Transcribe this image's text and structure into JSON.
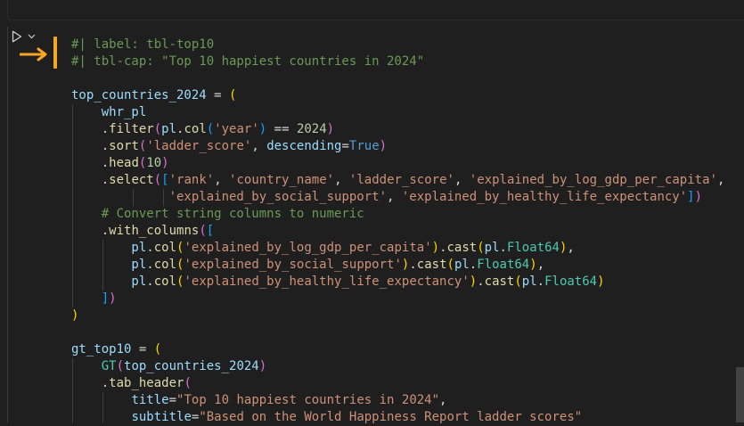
{
  "cell": {
    "run_button": "run-cell",
    "lines": [
      [
        {
          "t": "#| label: tbl-top10",
          "c": "tok-c"
        }
      ],
      [
        {
          "t": "#| tbl-cap: \"Top 10 happiest countries in 2024\"",
          "c": "tok-c"
        }
      ],
      [
        {
          "t": "",
          "c": "tok-op"
        }
      ],
      [
        {
          "t": "top_countries_2024",
          "c": "tok-v"
        },
        {
          "t": " = ",
          "c": "tok-op"
        },
        {
          "t": "(",
          "c": "tok-p1"
        }
      ],
      [
        {
          "t": "    whr_pl",
          "c": "tok-v"
        }
      ],
      [
        {
          "t": "    .",
          "c": "tok-op"
        },
        {
          "t": "filter",
          "c": "tok-f"
        },
        {
          "t": "(",
          "c": "tok-p2"
        },
        {
          "t": "pl",
          "c": "tok-v"
        },
        {
          "t": ".",
          "c": "tok-op"
        },
        {
          "t": "col",
          "c": "tok-f"
        },
        {
          "t": "(",
          "c": "tok-p3"
        },
        {
          "t": "'year'",
          "c": "tok-s"
        },
        {
          "t": ")",
          "c": "tok-p3"
        },
        {
          "t": " == ",
          "c": "tok-op"
        },
        {
          "t": "2024",
          "c": "tok-n"
        },
        {
          "t": ")",
          "c": "tok-p2"
        }
      ],
      [
        {
          "t": "    .",
          "c": "tok-op"
        },
        {
          "t": "sort",
          "c": "tok-f"
        },
        {
          "t": "(",
          "c": "tok-p2"
        },
        {
          "t": "'ladder_score'",
          "c": "tok-s"
        },
        {
          "t": ", ",
          "c": "tok-op"
        },
        {
          "t": "descending",
          "c": "tok-v"
        },
        {
          "t": "=",
          "c": "tok-op"
        },
        {
          "t": "True",
          "c": "tok-k"
        },
        {
          "t": ")",
          "c": "tok-p2"
        }
      ],
      [
        {
          "t": "    .",
          "c": "tok-op"
        },
        {
          "t": "head",
          "c": "tok-f"
        },
        {
          "t": "(",
          "c": "tok-p2"
        },
        {
          "t": "10",
          "c": "tok-n"
        },
        {
          "t": ")",
          "c": "tok-p2"
        }
      ],
      [
        {
          "t": "    .",
          "c": "tok-op"
        },
        {
          "t": "select",
          "c": "tok-f"
        },
        {
          "t": "(",
          "c": "tok-p2"
        },
        {
          "t": "[",
          "c": "tok-p3"
        },
        {
          "t": "'rank'",
          "c": "tok-s"
        },
        {
          "t": ", ",
          "c": "tok-op"
        },
        {
          "t": "'country_name'",
          "c": "tok-s"
        },
        {
          "t": ", ",
          "c": "tok-op"
        },
        {
          "t": "'ladder_score'",
          "c": "tok-s"
        },
        {
          "t": ", ",
          "c": "tok-op"
        },
        {
          "t": "'explained_by_log_gdp_per_capita'",
          "c": "tok-s"
        },
        {
          "t": ",",
          "c": "tok-op"
        }
      ],
      [
        {
          "t": "             ",
          "c": "tok-op"
        },
        {
          "t": "'explained_by_social_support'",
          "c": "tok-s"
        },
        {
          "t": ", ",
          "c": "tok-op"
        },
        {
          "t": "'explained_by_healthy_life_expectancy'",
          "c": "tok-s"
        },
        {
          "t": "]",
          "c": "tok-p3"
        },
        {
          "t": ")",
          "c": "tok-p2"
        }
      ],
      [
        {
          "t": "    # Convert string columns to numeric",
          "c": "tok-c"
        }
      ],
      [
        {
          "t": "    .",
          "c": "tok-op"
        },
        {
          "t": "with_columns",
          "c": "tok-f"
        },
        {
          "t": "(",
          "c": "tok-p2"
        },
        {
          "t": "[",
          "c": "tok-p3"
        }
      ],
      [
        {
          "t": "        pl",
          "c": "tok-v"
        },
        {
          "t": ".",
          "c": "tok-op"
        },
        {
          "t": "col",
          "c": "tok-f"
        },
        {
          "t": "(",
          "c": "tok-p1"
        },
        {
          "t": "'explained_by_log_gdp_per_capita'",
          "c": "tok-s"
        },
        {
          "t": ")",
          "c": "tok-p1"
        },
        {
          "t": ".",
          "c": "tok-op"
        },
        {
          "t": "cast",
          "c": "tok-f"
        },
        {
          "t": "(",
          "c": "tok-p1"
        },
        {
          "t": "pl",
          "c": "tok-v"
        },
        {
          "t": ".",
          "c": "tok-op"
        },
        {
          "t": "Float64",
          "c": "tok-cls"
        },
        {
          "t": ")",
          "c": "tok-p1"
        },
        {
          "t": ",",
          "c": "tok-op"
        }
      ],
      [
        {
          "t": "        pl",
          "c": "tok-v"
        },
        {
          "t": ".",
          "c": "tok-op"
        },
        {
          "t": "col",
          "c": "tok-f"
        },
        {
          "t": "(",
          "c": "tok-p1"
        },
        {
          "t": "'explained_by_social_support'",
          "c": "tok-s"
        },
        {
          "t": ")",
          "c": "tok-p1"
        },
        {
          "t": ".",
          "c": "tok-op"
        },
        {
          "t": "cast",
          "c": "tok-f"
        },
        {
          "t": "(",
          "c": "tok-p1"
        },
        {
          "t": "pl",
          "c": "tok-v"
        },
        {
          "t": ".",
          "c": "tok-op"
        },
        {
          "t": "Float64",
          "c": "tok-cls"
        },
        {
          "t": ")",
          "c": "tok-p1"
        },
        {
          "t": ",",
          "c": "tok-op"
        }
      ],
      [
        {
          "t": "        pl",
          "c": "tok-v"
        },
        {
          "t": ".",
          "c": "tok-op"
        },
        {
          "t": "col",
          "c": "tok-f"
        },
        {
          "t": "(",
          "c": "tok-p1"
        },
        {
          "t": "'explained_by_healthy_life_expectancy'",
          "c": "tok-s"
        },
        {
          "t": ")",
          "c": "tok-p1"
        },
        {
          "t": ".",
          "c": "tok-op"
        },
        {
          "t": "cast",
          "c": "tok-f"
        },
        {
          "t": "(",
          "c": "tok-p1"
        },
        {
          "t": "pl",
          "c": "tok-v"
        },
        {
          "t": ".",
          "c": "tok-op"
        },
        {
          "t": "Float64",
          "c": "tok-cls"
        },
        {
          "t": ")",
          "c": "tok-p1"
        }
      ],
      [
        {
          "t": "    ",
          "c": "tok-op"
        },
        {
          "t": "]",
          "c": "tok-p3"
        },
        {
          "t": ")",
          "c": "tok-p2"
        }
      ],
      [
        {
          "t": ")",
          "c": "tok-p1"
        }
      ],
      [
        {
          "t": "",
          "c": "tok-op"
        }
      ],
      [
        {
          "t": "gt_top10",
          "c": "tok-v"
        },
        {
          "t": " = ",
          "c": "tok-op"
        },
        {
          "t": "(",
          "c": "tok-p1"
        }
      ],
      [
        {
          "t": "    ",
          "c": "tok-op"
        },
        {
          "t": "GT",
          "c": "tok-cls"
        },
        {
          "t": "(",
          "c": "tok-p2"
        },
        {
          "t": "top_countries_2024",
          "c": "tok-v"
        },
        {
          "t": ")",
          "c": "tok-p2"
        }
      ],
      [
        {
          "t": "    .",
          "c": "tok-op"
        },
        {
          "t": "tab_header",
          "c": "tok-f"
        },
        {
          "t": "(",
          "c": "tok-p2"
        }
      ],
      [
        {
          "t": "        ",
          "c": "tok-op"
        },
        {
          "t": "title",
          "c": "tok-v"
        },
        {
          "t": "=",
          "c": "tok-op"
        },
        {
          "t": "\"Top 10 happiest countries in 2024\"",
          "c": "tok-s"
        },
        {
          "t": ",",
          "c": "tok-op"
        }
      ],
      [
        {
          "t": "        ",
          "c": "tok-op"
        },
        {
          "t": "subtitle",
          "c": "tok-v"
        },
        {
          "t": "=",
          "c": "tok-op"
        },
        {
          "t": "\"Based on the World Happiness Report ladder scores\"",
          "c": "tok-s"
        }
      ]
    ]
  },
  "colors": {
    "accent": "#f6a623",
    "background": "#1f1f1f"
  }
}
